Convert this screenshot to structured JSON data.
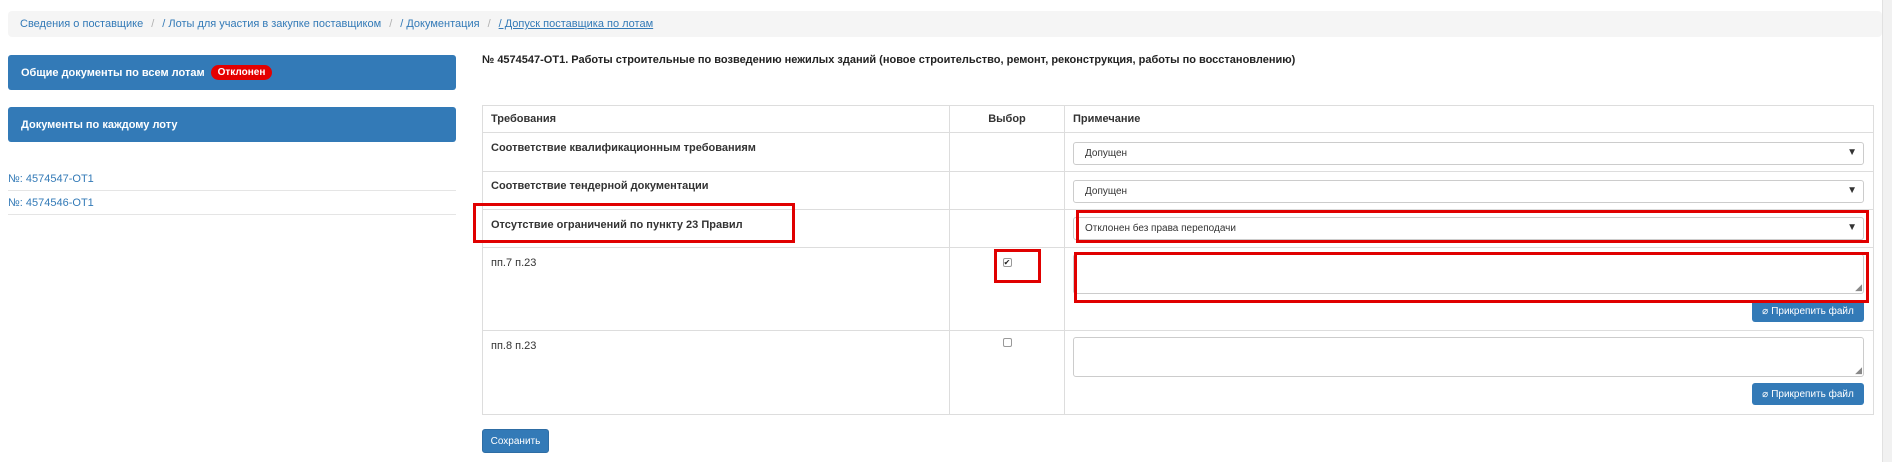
{
  "breadcrumb": {
    "items": [
      "Сведения о поставщике",
      "/ Лоты для участия в закупке поставщиком",
      "/ Документация",
      "/ Допуск поставщика по лотам"
    ],
    "separator": "/"
  },
  "sidebar": {
    "general_docs_label": "Общие документы по всем лотам",
    "general_docs_badge": "Отклонен",
    "per_lot_docs_label": "Документы по каждому лоту",
    "lots": [
      "№: 4574547-ОТ1",
      "№: 4574546-ОТ1"
    ]
  },
  "main": {
    "lot_title": "№ 4574547-ОТ1. Работы строительные по возведению нежилых зданий (новое строительство, ремонт, реконструкция, работы по восстановлению)",
    "table": {
      "headers": [
        "Требования",
        "Выбор",
        "Примечание"
      ],
      "rows": [
        {
          "requirement": "Соответствие квалификационным требованиям",
          "note_value": "Допущен"
        },
        {
          "requirement": "Соответствие тендерной документации",
          "note_value": "Допущен"
        },
        {
          "requirement": "Отсутствие ограничений по пункту 23 Правил",
          "note_value": "Отклонен без права переподачи"
        },
        {
          "requirement": "пп.7 п.23",
          "checked": true,
          "note_value": "",
          "attach_label": "Прикрепить файл"
        },
        {
          "requirement": "пп.8 п.23",
          "checked": false,
          "note_value": "",
          "attach_label": "Прикрепить файл"
        }
      ]
    },
    "save_label": "Сохранить"
  },
  "colors": {
    "primary": "#337ab7",
    "badge_red": "#e40000",
    "highlight": "#e00000"
  },
  "icons": {
    "dropdown": "triangle-down-icon",
    "attach": "paperclip-icon",
    "resize": "resize-grip-icon"
  }
}
